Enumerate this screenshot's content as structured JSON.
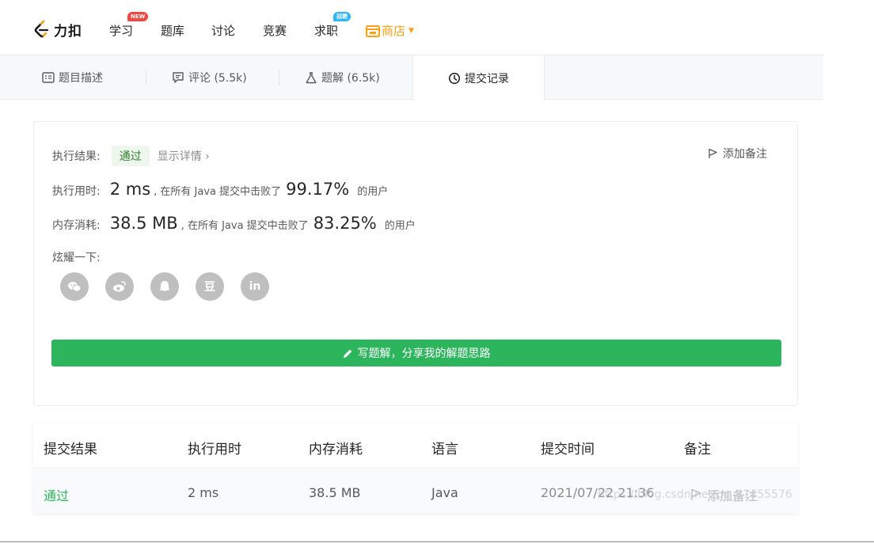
{
  "nav": {
    "logo_text": "力扣",
    "items": [
      {
        "label": "学习",
        "badge": "NEW"
      },
      {
        "label": "题库"
      },
      {
        "label": "讨论"
      },
      {
        "label": "竞赛"
      },
      {
        "label": "求职",
        "badge": "招聘"
      }
    ],
    "shop_label": "商店",
    "colors": {
      "shop": "#ffa116",
      "badge_new": "#ef4743",
      "badge_hire": "#2db7f5"
    }
  },
  "tabs": [
    {
      "label": "题目描述",
      "icon": "description-icon"
    },
    {
      "label": "评论 (5.5k)",
      "icon": "comment-icon"
    },
    {
      "label": "题解 (6.5k)",
      "icon": "flask-icon"
    },
    {
      "label": "提交记录",
      "icon": "clock-icon",
      "active": true
    }
  ],
  "result": {
    "status_label": "执行结果:",
    "status_value": "通过",
    "detail_link": "显示详情 ›",
    "add_note": "添加备注",
    "runtime_label": "执行用时:",
    "runtime_value": "2 ms",
    "runtime_desc": ", 在所有 Java 提交中击败了",
    "runtime_pct": "99.17%",
    "runtime_suffix": "的用户",
    "memory_label": "内存消耗:",
    "memory_value": "38.5 MB",
    "memory_desc": ", 在所有 Java 提交中击败了",
    "memory_pct": "83.25%",
    "memory_suffix": "的用户",
    "share_label": "炫耀一下:",
    "share_buttons": [
      "wechat-icon",
      "weibo-icon",
      "qq-icon",
      "douban-icon",
      "linkedin-icon"
    ],
    "douban_glyph": "豆",
    "linkedin_glyph": "in",
    "write_button": "写题解，分享我的解题思路",
    "colors": {
      "accent_green": "#2db55d"
    }
  },
  "table": {
    "headers": [
      "提交结果",
      "执行用时",
      "内存消耗",
      "语言",
      "提交时间",
      "备注"
    ],
    "row": {
      "status": "通过",
      "runtime": "2 ms",
      "memory": "38.5 MB",
      "language": "Java",
      "time": "2021/07/22 21:36",
      "note": "添加备注"
    }
  },
  "watermark": "https://blog.csdn.net/qq_41455576"
}
